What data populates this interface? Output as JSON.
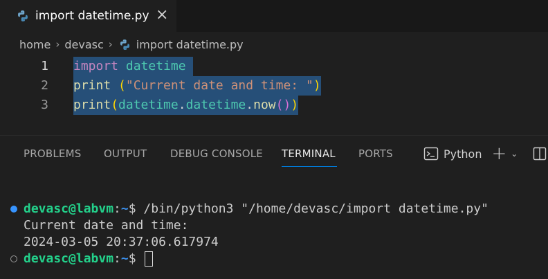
{
  "tab": {
    "label": "import datetime.py",
    "close": "×"
  },
  "breadcrumb": {
    "items": [
      "home",
      "devasc",
      "import datetime.py"
    ],
    "separator": "›"
  },
  "editor": {
    "lines": [
      {
        "num": "1"
      },
      {
        "num": "2"
      },
      {
        "num": "3"
      }
    ],
    "tokens": {
      "import_kw": "import",
      "module": "datetime",
      "print1": "print",
      "open1": "(",
      "str1": "\"Current date and time: \"",
      "close1": ")",
      "print2": "print",
      "open2": "(",
      "dt1": "datetime",
      "dot1": ".",
      "dt2": "datetime",
      "dot2": ".",
      "now": "now",
      "open3": "(",
      "close3": ")",
      "close2": ")"
    }
  },
  "panel": {
    "tabs": [
      "PROBLEMS",
      "OUTPUT",
      "DEBUG CONSOLE",
      "TERMINAL",
      "PORTS"
    ],
    "active_tab": "TERMINAL",
    "terminal_name": "Python",
    "plus": "+",
    "chevron": "⌄"
  },
  "terminal": {
    "prompt_user": "devasc@labvm",
    "prompt_path": "~",
    "prompt_colon": ":",
    "prompt_dollar": "$",
    "command": " /bin/python3 \"/home/devasc/import datetime.py\"",
    "output1": "Current date and time:",
    "output2": "2024-03-05 20:37:06.617974"
  },
  "colors": {
    "accent": "#0078d4",
    "selection": "#264f78",
    "prompt_user": "#23d18b",
    "prompt_path": "#3b8eea"
  }
}
